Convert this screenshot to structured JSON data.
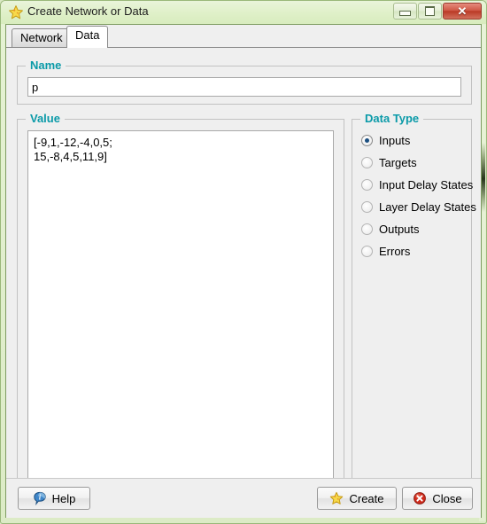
{
  "window": {
    "title": "Create Network or Data",
    "icon": "star-icon",
    "controls": {
      "minimize": "minimize-icon",
      "maximize": "maximize-icon",
      "close": "✕"
    }
  },
  "tabs": [
    {
      "label": "Network",
      "active": false
    },
    {
      "label": "Data",
      "active": true
    }
  ],
  "name_group": {
    "title": "Name",
    "value": "p",
    "placeholder": ""
  },
  "value_group": {
    "title": "Value",
    "value": "[-9,1,-12,-4,0,5;\n15,-8,4,5,11,9]",
    "placeholder": ""
  },
  "data_type_group": {
    "title": "Data Type",
    "options": [
      {
        "label": "Inputs",
        "selected": true
      },
      {
        "label": "Targets",
        "selected": false
      },
      {
        "label": "Input Delay States",
        "selected": false
      },
      {
        "label": "Layer Delay States",
        "selected": false
      },
      {
        "label": "Outputs",
        "selected": false
      },
      {
        "label": "Errors",
        "selected": false
      }
    ]
  },
  "buttons": {
    "help": {
      "label": "Help",
      "icon": "info-bubble-icon"
    },
    "create": {
      "label": "Create",
      "icon": "star-icon"
    },
    "close": {
      "label": "Close",
      "icon": "error-circle-icon"
    }
  },
  "colors": {
    "group_title": "#0a9aa8",
    "titlebar": "#dff0c8",
    "close_button": "#ba3a26",
    "radio_dot": "#1b4f80"
  }
}
